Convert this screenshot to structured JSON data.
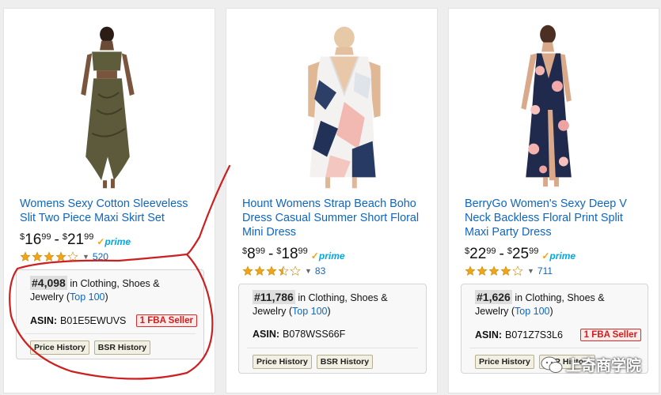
{
  "products": [
    {
      "title": "Womens Sexy Cotton Sleeveless Slit Two Piece Maxi Skirt Set",
      "price_low_dollars": "16",
      "price_low_cents": "99",
      "price_high_dollars": "21",
      "price_high_cents": "99",
      "prime": "prime",
      "rating": 4.0,
      "reviews": "520",
      "rank": "#4,098",
      "category_text": "in Clothing, Shoes & Jewelry",
      "top_link": "Top 100",
      "asin_label": "ASIN:",
      "asin": "B01E5EWUVS",
      "fba": "1 FBA Seller",
      "btn_price": "Price History",
      "btn_bsr": "BSR History"
    },
    {
      "title": "Hount Womens Strap Beach Boho Dress Casual Summer Short Floral Mini Dress",
      "price_low_dollars": "8",
      "price_low_cents": "99",
      "price_high_dollars": "18",
      "price_high_cents": "99",
      "prime": "prime",
      "rating": 3.5,
      "reviews": "83",
      "rank": "#11,786",
      "category_text": "in Clothing, Shoes & Jewelry",
      "top_link": "Top 100",
      "asin_label": "ASIN:",
      "asin": "B078WSS66F",
      "fba": "",
      "btn_price": "Price History",
      "btn_bsr": "BSR History"
    },
    {
      "title": "BerryGo Women's Sexy Deep V Neck Backless Floral Print Split Maxi Party Dress",
      "price_low_dollars": "22",
      "price_low_cents": "99",
      "price_high_dollars": "25",
      "price_high_cents": "99",
      "prime": "prime",
      "rating": 4.0,
      "reviews": "711",
      "rank": "#1,626",
      "category_text": "in Clothing, Shoes & Jewelry",
      "top_link": "Top 100",
      "asin_label": "ASIN:",
      "asin": "B071Z7S3L6",
      "fba": "1 FBA Seller",
      "btn_price": "Price History",
      "btn_bsr": "BSR History"
    }
  ],
  "watermark": "上奇商学院",
  "colors": {
    "link": "#0f66c0",
    "star": "#f0a416",
    "prime": "#00a8e1",
    "annotation": "#cc1f1f"
  }
}
